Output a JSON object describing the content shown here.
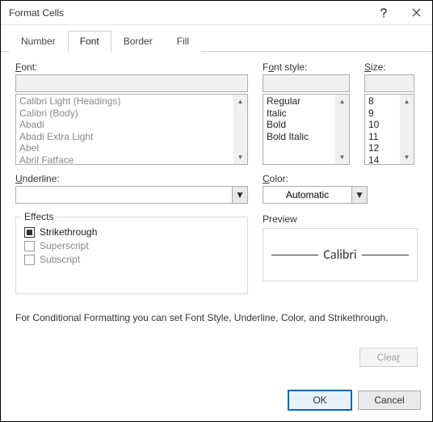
{
  "dialog": {
    "title": "Format Cells"
  },
  "tabs": {
    "items": [
      "Number",
      "Font",
      "Border",
      "Fill"
    ],
    "active": "Font"
  },
  "font": {
    "label": "Font:",
    "value": "",
    "options": [
      "Calibri Light (Headings)",
      "Calibri (Body)",
      "Abadi",
      "Abadi Extra Light",
      "Abel",
      "Abril Fatface"
    ]
  },
  "font_style": {
    "label": "Font style:",
    "value": "",
    "options": [
      "Regular",
      "Italic",
      "Bold",
      "Bold Italic"
    ]
  },
  "size": {
    "label": "Size:",
    "value": "",
    "options": [
      "8",
      "9",
      "10",
      "11",
      "12",
      "14"
    ]
  },
  "underline": {
    "label": "Underline:",
    "value": ""
  },
  "color": {
    "label": "Color:",
    "value": "Automatic"
  },
  "effects": {
    "label": "Effects",
    "strikethrough": {
      "label": "Strikethrough",
      "checked": true,
      "enabled": true
    },
    "superscript": {
      "label": "Superscript",
      "checked": false,
      "enabled": false
    },
    "subscript": {
      "label": "Subscript",
      "checked": false,
      "enabled": false
    }
  },
  "preview": {
    "label": "Preview",
    "sample": "Calibri"
  },
  "description": "For Conditional Formatting you can set Font Style, Underline, Color, and Strikethrough.",
  "buttons": {
    "clear": "Clear",
    "ok": "OK",
    "cancel": "Cancel"
  }
}
